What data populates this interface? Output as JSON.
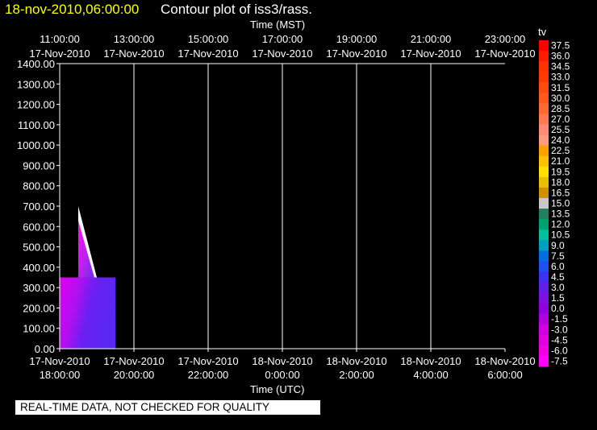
{
  "title": {
    "datetime": "18-nov-2010,06:00:00",
    "text": "Contour plot of iss3/rass."
  },
  "quality_note": "REAL-TIME DATA, NOT CHECKED FOR QUALITY",
  "colors": {
    "background": "#000000",
    "grid": "#ffffff",
    "title_date": "#ffff00"
  },
  "chart_data": {
    "type": "heatmap",
    "xlabel_top": "Time (MST)",
    "xlabel_bottom": "Time (UTC)",
    "ylabel": "",
    "ylim": [
      0,
      1400
    ],
    "yticks": [
      "0.00",
      "100.00",
      "200.00",
      "300.00",
      "400.00",
      "500.00",
      "600.00",
      "700.00",
      "800.00",
      "900.00",
      "1000.00",
      "1100.00",
      "1200.00",
      "1300.00",
      "1400.00"
    ],
    "xlim_utc": [
      "17-Nov-2010 18:00",
      "18-Nov-2010 06:00"
    ],
    "xticks_top": [
      {
        "time": "11:00:00",
        "date": "17-Nov-2010"
      },
      {
        "time": "13:00:00",
        "date": "17-Nov-2010"
      },
      {
        "time": "15:00:00",
        "date": "17-Nov-2010"
      },
      {
        "time": "17:00:00",
        "date": "17-Nov-2010"
      },
      {
        "time": "19:00:00",
        "date": "17-Nov-2010"
      },
      {
        "time": "21:00:00",
        "date": "17-Nov-2010"
      },
      {
        "time": "23:00:00",
        "date": "17-Nov-2010"
      }
    ],
    "xticks_bottom": [
      {
        "date": "17-Nov-2010",
        "time": "18:00:00"
      },
      {
        "date": "17-Nov-2010",
        "time": "20:00:00"
      },
      {
        "date": "17-Nov-2010",
        "time": "22:00:00"
      },
      {
        "date": "18-Nov-2010",
        "time": "0:00:00"
      },
      {
        "date": "18-Nov-2010",
        "time": "2:00:00"
      },
      {
        "date": "18-Nov-2010",
        "time": "4:00:00"
      },
      {
        "date": "18-Nov-2010",
        "time": "6:00:00"
      }
    ],
    "grid": true,
    "colorbar": {
      "label": "tv",
      "levels": [
        "37.5",
        "36.0",
        "34.5",
        "33.0",
        "31.5",
        "30.0",
        "28.5",
        "27.0",
        "25.5",
        "24.0",
        "22.5",
        "21.0",
        "19.5",
        "18.0",
        "16.5",
        "15.0",
        "13.5",
        "12.0",
        "10.5",
        "9.0",
        "7.5",
        "6.0",
        "4.5",
        "3.0",
        "1.5",
        "0.0",
        "-1.5",
        "-3.0",
        "-4.5",
        "-6.0",
        "-7.5"
      ],
      "colors": [
        "#ff0000",
        "#ff1a00",
        "#ff3300",
        "#ff3b00",
        "#ff4a10",
        "#ff5a1e",
        "#ff6a30",
        "#ff7a50",
        "#ff8a7a",
        "#ff9a7a",
        "#ffa000",
        "#ffc000",
        "#ffe000",
        "#e8c000",
        "#d09000",
        "#c8c8c8",
        "#208060",
        "#00a070",
        "#00c0a0",
        "#00a0c0",
        "#0070e0",
        "#2050f0",
        "#4030f0",
        "#6020e8",
        "#8010e0",
        "#9000e0",
        "#b000e0",
        "#d000e0",
        "#e000e0",
        "#f000e0",
        "#ff00ff"
      ]
    },
    "observed_region": {
      "block": {
        "time_utc": [
          "18:00",
          "19:30"
        ],
        "height": [
          0,
          350
        ],
        "value_range": [
          -6.0,
          4.5
        ]
      },
      "spike": {
        "time_utc": [
          "18:30",
          "19:00"
        ],
        "height": [
          350,
          700
        ],
        "value_range": [
          -7.5,
          3.0
        ]
      }
    }
  }
}
